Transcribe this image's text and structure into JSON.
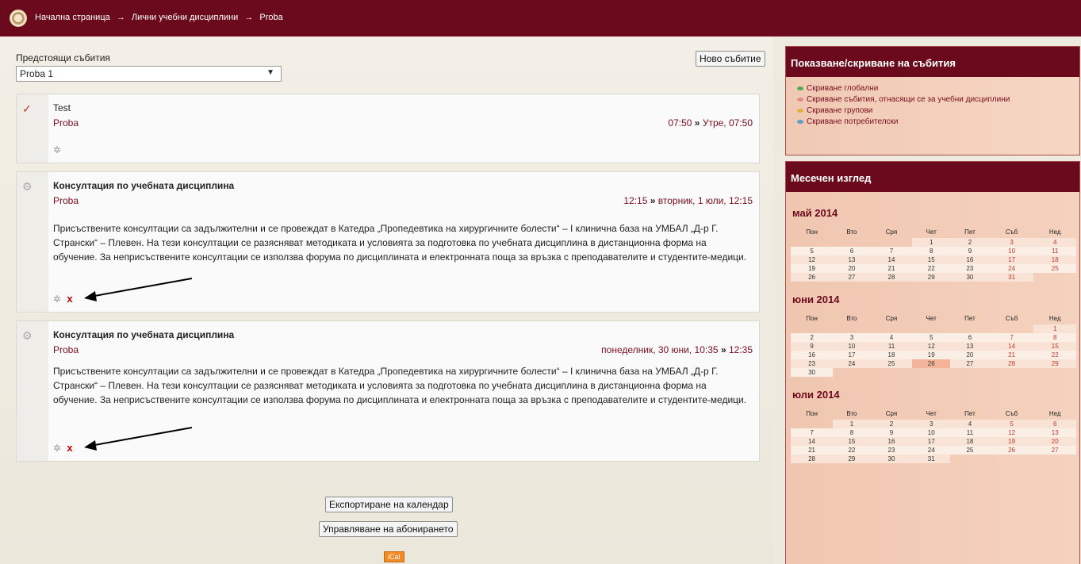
{
  "breadcrumb": [
    "Начална страница",
    "Лични учебни дисциплини",
    "Proba"
  ],
  "breadcrumb_separator": "→",
  "upcoming": {
    "label": "Предстоящи събития",
    "select_value": "Proba 1",
    "new_event_button": "Ново събитие"
  },
  "events": [
    {
      "title": "Test",
      "course": "Proba",
      "date_start": "07:50",
      "date_sep": "»",
      "date_end": "Утре, 07:50",
      "description": ""
    },
    {
      "title": "Консултация по учебната дисциплина",
      "course": "Proba",
      "date_start": "12:15",
      "date_sep": "»",
      "date_end": "вторник, 1 юли, 12:15",
      "description": "Присъствените консултации са задължителни и се провеждат в Катедра „Пропедевтика на хирургичните болести“ – I клинична база на УМБАЛ „Д-р Г. Странски“ – Плевен. На тези консултации се разясняват методиката и условията за подготовка по учебната дисциплина в дистанционна форма на обучение. За неприсъствените консултации се използва форума по дисциплината и електронната поща за връзка с преподавателите и студентите-медици.",
      "delete_label": "x"
    },
    {
      "title": "Консултация по учебната дисциплина",
      "course": "Proba",
      "date_start": "понеделник, 30 юни, 10:35",
      "date_sep": "»",
      "date_end": "12:35",
      "description": "Присъствените консултации са задължителни и се провеждат в Катедра „Пропедевтика на хирургичните болести“ – I клинична база на УМБАЛ „Д-р Г. Странски“ – Плевен. На тези консултации се разясняват методиката и условията за подготовка по учебната дисциплина в дистанционна форма на обучение. За неприсъствените консултации се използва форума по дисциплината и електронната поща за връзка с преподавателите и студентите-медици.",
      "delete_label": "x"
    }
  ],
  "footer": {
    "export_button": "Експортиране на календар",
    "manage_button": "Управляване на абонирането",
    "ical_label": "iCal"
  },
  "filters": {
    "title": "Показване/скриване на събития",
    "items": [
      {
        "label": "Скриване глобални",
        "color": "#4caf50"
      },
      {
        "label": "Скриване събития, отнасящи се за учебни дисциплини",
        "color": "#e08a8a"
      },
      {
        "label": "Скриване групови",
        "color": "#e0b040"
      },
      {
        "label": "Скриване потребителски",
        "color": "#5aa0c8"
      }
    ]
  },
  "monthly": {
    "title": "Месечен изглед",
    "weekdays": [
      "Пон",
      "Вто",
      "Сря",
      "Чет",
      "Пет",
      "Съб",
      "Нед"
    ],
    "months": [
      {
        "title": "май 2014",
        "weeks": [
          [
            "",
            "",
            "",
            "1",
            "2",
            "3",
            "4"
          ],
          [
            "5",
            "6",
            "7",
            "8",
            "9",
            "10",
            "11"
          ],
          [
            "12",
            "13",
            "14",
            "15",
            "16",
            "17",
            "18"
          ],
          [
            "19",
            "20",
            "21",
            "22",
            "23",
            "24",
            "25"
          ],
          [
            "26",
            "27",
            "28",
            "29",
            "30",
            "31",
            ""
          ]
        ]
      },
      {
        "title": "юни 2014",
        "today": "26",
        "weeks": [
          [
            "",
            "",
            "",
            "",
            "",
            "",
            "1"
          ],
          [
            "2",
            "3",
            "4",
            "5",
            "6",
            "7",
            "8"
          ],
          [
            "9",
            "10",
            "11",
            "12",
            "13",
            "14",
            "15"
          ],
          [
            "16",
            "17",
            "18",
            "19",
            "20",
            "21",
            "22"
          ],
          [
            "23",
            "24",
            "25",
            "26",
            "27",
            "28",
            "29"
          ],
          [
            "30",
            "",
            "",
            "",
            "",
            "",
            ""
          ]
        ]
      },
      {
        "title": "юли 2014",
        "weeks": [
          [
            "",
            "1",
            "2",
            "3",
            "4",
            "5",
            "6"
          ],
          [
            "7",
            "8",
            "9",
            "10",
            "11",
            "12",
            "13"
          ],
          [
            "14",
            "15",
            "16",
            "17",
            "18",
            "19",
            "20"
          ],
          [
            "21",
            "22",
            "23",
            "24",
            "25",
            "26",
            "27"
          ],
          [
            "28",
            "29",
            "30",
            "31",
            "",
            "",
            ""
          ]
        ]
      }
    ]
  },
  "colors": {
    "brand": "#6b0a1c",
    "link": "#7a0d1e",
    "sidebar_bg": "#f0c9b4"
  }
}
